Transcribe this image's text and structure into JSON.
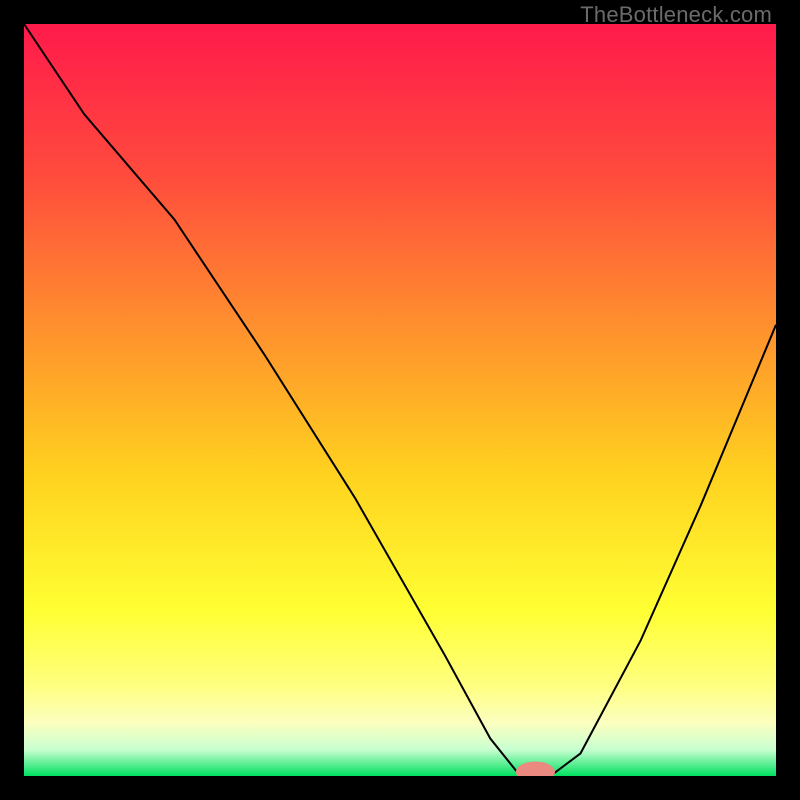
{
  "watermark": "TheBottleneck.com",
  "chart_data": {
    "type": "line",
    "title": "",
    "xlabel": "",
    "ylabel": "",
    "xlim": [
      0,
      100
    ],
    "ylim": [
      0,
      100
    ],
    "grid": false,
    "background_gradient": {
      "stops": [
        {
          "offset": 0.0,
          "color": "#ff1a4b"
        },
        {
          "offset": 0.2,
          "color": "#ff4b3d"
        },
        {
          "offset": 0.4,
          "color": "#ff8f2e"
        },
        {
          "offset": 0.6,
          "color": "#ffd21f"
        },
        {
          "offset": 0.78,
          "color": "#ffff33"
        },
        {
          "offset": 0.88,
          "color": "#ffff80"
        },
        {
          "offset": 0.93,
          "color": "#fbffc0"
        },
        {
          "offset": 0.965,
          "color": "#c8ffd0"
        },
        {
          "offset": 1.0,
          "color": "#00e060"
        }
      ]
    },
    "series": [
      {
        "name": "bottleneck-curve",
        "color": "#000000",
        "stroke_width": 2,
        "x": [
          0,
          8,
          20,
          32,
          44,
          56,
          62,
          66,
          70,
          74,
          82,
          90,
          100
        ],
        "y": [
          100,
          88,
          74,
          56,
          37,
          16,
          5,
          0,
          0,
          3,
          18,
          36,
          60
        ]
      }
    ],
    "marker": {
      "name": "optimal-point",
      "shape": "pill",
      "color": "#e9897f",
      "cx": 68,
      "cy": 0,
      "rx": 2.6,
      "ry": 1.0
    }
  }
}
